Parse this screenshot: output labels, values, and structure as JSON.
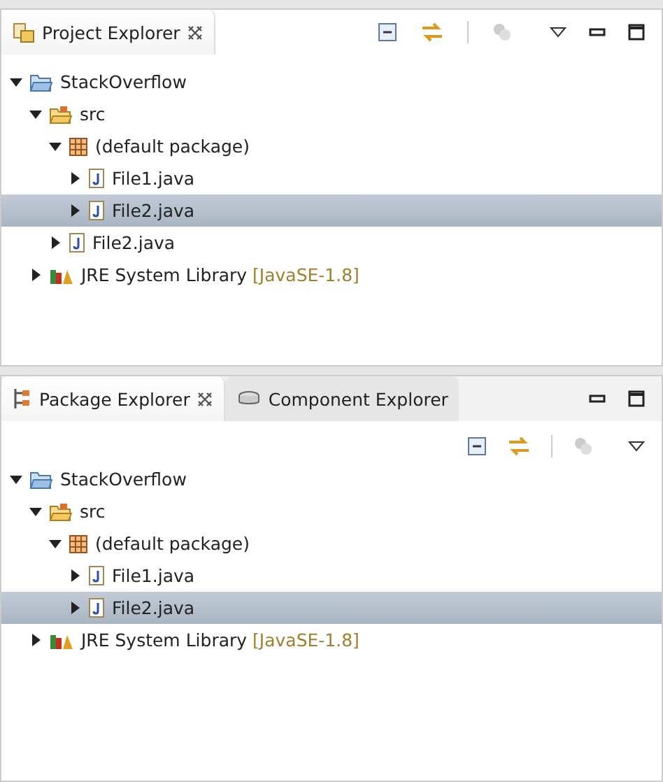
{
  "panels": [
    {
      "tabs": [
        {
          "label": "Project Explorer",
          "kind": "project",
          "selected": true,
          "closable": true
        }
      ],
      "tree": [
        {
          "label": "StackOverflow",
          "kind": "project",
          "expanded": true,
          "selected": false,
          "children": [
            {
              "label": "src",
              "kind": "source-folder",
              "expanded": true,
              "selected": false,
              "children": [
                {
                  "label": "(default package)",
                  "kind": "package",
                  "expanded": true,
                  "selected": false,
                  "children": [
                    {
                      "label": "File1.java",
                      "kind": "java-file",
                      "expanded": false,
                      "selected": false
                    },
                    {
                      "label": "File2.java",
                      "kind": "java-file",
                      "expanded": false,
                      "selected": true
                    }
                  ]
                },
                {
                  "label": "File2.java",
                  "kind": "java-file",
                  "expanded": false,
                  "selected": false
                }
              ]
            },
            {
              "label": "JRE System Library",
              "qualifier": "[JavaSE-1.8]",
              "kind": "library",
              "expanded": false,
              "selected": false
            }
          ]
        }
      ]
    },
    {
      "tabs": [
        {
          "label": "Package Explorer",
          "kind": "package",
          "selected": true,
          "closable": true
        },
        {
          "label": "Component Explorer",
          "kind": "component",
          "selected": false,
          "closable": false
        }
      ],
      "tree": [
        {
          "label": "StackOverflow",
          "kind": "project",
          "expanded": true,
          "selected": false,
          "children": [
            {
              "label": "src",
              "kind": "source-folder",
              "expanded": true,
              "selected": false,
              "children": [
                {
                  "label": "(default package)",
                  "kind": "package",
                  "expanded": true,
                  "selected": false,
                  "children": [
                    {
                      "label": "File1.java",
                      "kind": "java-file",
                      "expanded": false,
                      "selected": false
                    },
                    {
                      "label": "File2.java",
                      "kind": "java-file",
                      "expanded": false,
                      "selected": true
                    }
                  ]
                }
              ]
            },
            {
              "label": "JRE System Library",
              "qualifier": "[JavaSE-1.8]",
              "kind": "library",
              "expanded": false,
              "selected": false
            }
          ]
        }
      ]
    }
  ]
}
